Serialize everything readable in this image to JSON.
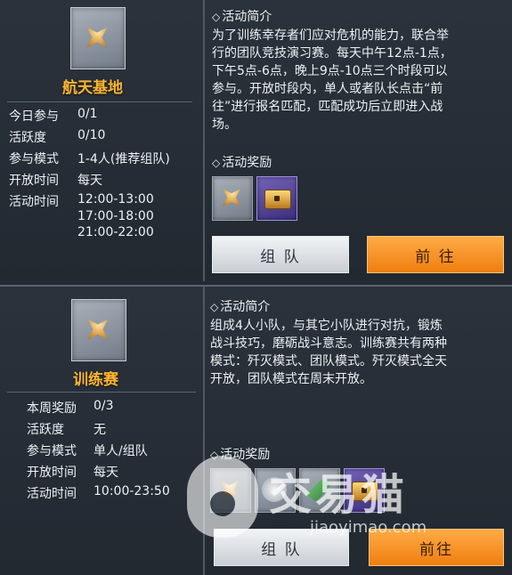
{
  "events": [
    {
      "title": "航天基地",
      "stats": [
        {
          "label": "今日参与",
          "value": "0/1"
        },
        {
          "label": "活跃度",
          "value": "0/10"
        },
        {
          "label": "参与模式",
          "value": "1-4人(推荐组队)"
        },
        {
          "label": "开放时间",
          "value": "每天"
        },
        {
          "label": "活动时间",
          "value": "12:00-13:00"
        }
      ],
      "extra_times": [
        "17:00-18:00",
        "21:00-22:00"
      ],
      "intro_heading": "活动简介",
      "intro_lines": [
        "为了训练幸存者们应对危机的能力，联合举",
        "行的团队竞技演习赛。每天中午12点-1点，",
        "下午5点-6点，晚上9点-10点三个时段可以",
        "参与。开放时段内，单人或者队长点击“前",
        "往”进行报名匹配，匹配成功后立即进入战",
        "场。"
      ],
      "reward_heading": "活动奖励",
      "rewards": [
        "emblem-icon",
        "chest-icon"
      ],
      "team_button": "组 队",
      "go_button": "前 往"
    },
    {
      "title": "训练赛",
      "stats": [
        {
          "label": "本周奖励",
          "value": "0/3"
        },
        {
          "label": "活跃度",
          "value": "无"
        },
        {
          "label": "参与模式",
          "value": "单人/组队"
        },
        {
          "label": "开放时间",
          "value": "每天"
        },
        {
          "label": "活动时间",
          "value": "10:00-23:50"
        }
      ],
      "intro_heading": "活动简介",
      "intro_lines": [
        "组成4人小队，与其它小队进行对抗，锻炼",
        "战斗技巧，磨砺战斗意志。训练赛共有两种",
        "模式：歼灭模式、团队模式。歼灭模式全天",
        "开放，团队模式在周末开放。"
      ],
      "reward_heading": "活动奖励",
      "team_button": "组 队",
      "go_button": "前往"
    }
  ],
  "watermark": {
    "name": "交易猫",
    "url": "jiaoyimao.com"
  },
  "colors": {
    "accent_orange": "#ef7e10",
    "title_gold": "#ffb52e",
    "panel_bg": "#2a323c"
  }
}
